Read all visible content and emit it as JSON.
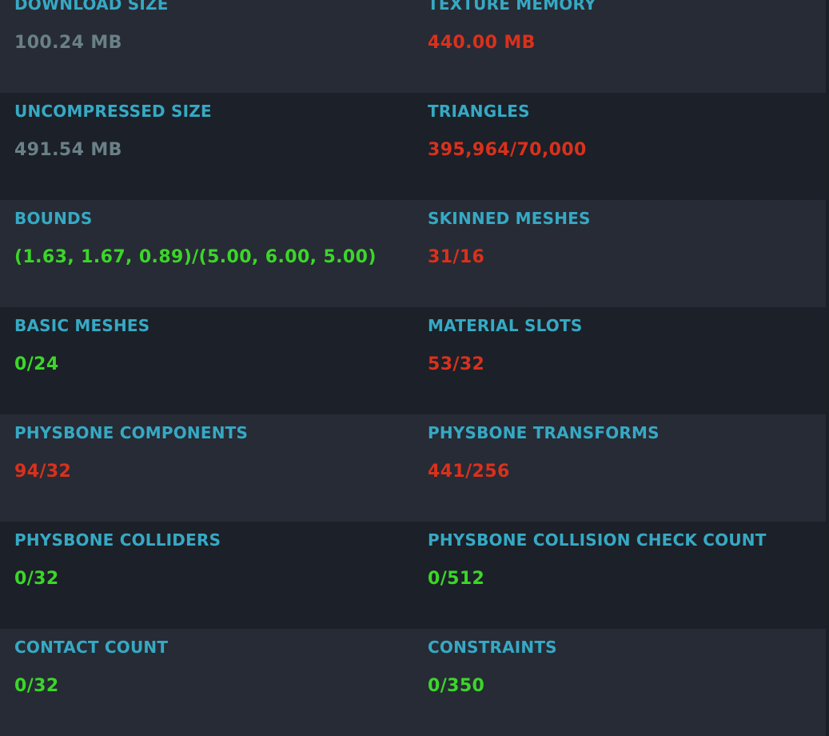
{
  "colors": {
    "label": "#36a9c4",
    "neutral": "#6a8087",
    "bad": "#d9311c",
    "good": "#3bd629",
    "row_odd": "#272b35",
    "row_even": "#1c2028"
  },
  "stats": [
    {
      "left": {
        "label": "DOWNLOAD SIZE",
        "value": "100.24 MB",
        "status": "neutral"
      },
      "right": {
        "label": "TEXTURE MEMORY",
        "value": "440.00 MB",
        "status": "bad"
      }
    },
    {
      "left": {
        "label": "UNCOMPRESSED SIZE",
        "value": "491.54 MB",
        "status": "neutral"
      },
      "right": {
        "label": "TRIANGLES",
        "value": "395,964/70,000",
        "status": "bad"
      }
    },
    {
      "left": {
        "label": "BOUNDS",
        "value": "(1.63, 1.67, 0.89)/(5.00, 6.00, 5.00)",
        "status": "good"
      },
      "right": {
        "label": "SKINNED MESHES",
        "value": "31/16",
        "status": "bad"
      }
    },
    {
      "left": {
        "label": "BASIC MESHES",
        "value": "0/24",
        "status": "good"
      },
      "right": {
        "label": "MATERIAL SLOTS",
        "value": "53/32",
        "status": "bad"
      }
    },
    {
      "left": {
        "label": "PHYSBONE COMPONENTS",
        "value": "94/32",
        "status": "bad"
      },
      "right": {
        "label": "PHYSBONE TRANSFORMS",
        "value": "441/256",
        "status": "bad"
      }
    },
    {
      "left": {
        "label": "PHYSBONE COLLIDERS",
        "value": "0/32",
        "status": "good"
      },
      "right": {
        "label": "PHYSBONE COLLISION CHECK COUNT",
        "value": "0/512",
        "status": "good"
      }
    },
    {
      "left": {
        "label": "CONTACT COUNT",
        "value": "0/32",
        "status": "good"
      },
      "right": {
        "label": "CONSTRAINTS",
        "value": "0/350",
        "status": "good"
      }
    }
  ]
}
